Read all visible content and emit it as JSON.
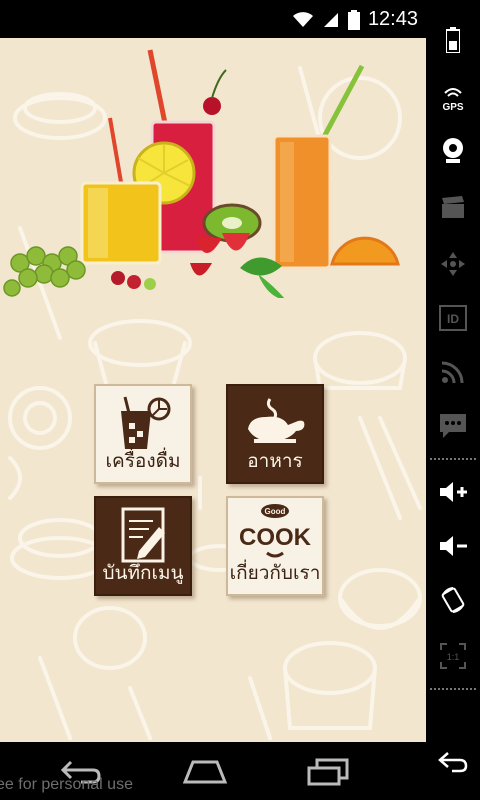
{
  "status_bar": {
    "time": "12:43",
    "icons": [
      "wifi-icon",
      "signal-icon",
      "battery-icon"
    ]
  },
  "menu": {
    "tiles": [
      {
        "label": "เครื่องดื่ม",
        "icon": "drink-icon",
        "style": "light"
      },
      {
        "label": "อาหาร",
        "icon": "chicken-icon",
        "style": "dark"
      },
      {
        "label": "บันทึกเมนู",
        "icon": "note-edit-icon",
        "style": "dark"
      },
      {
        "label": "เกี่ยวกับเรา",
        "icon": "good-cook-logo",
        "style": "light"
      }
    ],
    "logo_text": {
      "small": "Good",
      "large": "COOK"
    }
  },
  "emulator_sidebar": {
    "items": [
      "battery-icon",
      "gps-icon",
      "webcam-icon",
      "clapper-icon",
      "dpad-icon",
      "id-icon",
      "rss-icon",
      "sms-icon",
      "volume-up-icon",
      "volume-down-icon",
      "rotate-icon",
      "scale-icon",
      "back-icon"
    ],
    "gps_label": "GPS",
    "id_label": "ID",
    "scale_label": "1:1"
  },
  "nav_bar": {
    "buttons": [
      "back-button",
      "home-button",
      "recents-button"
    ]
  },
  "watermark": "ee for personal use",
  "colors": {
    "background": "#f3e6cf",
    "tile_dark": "#4a2a17",
    "tile_light": "#f7f1e6"
  }
}
